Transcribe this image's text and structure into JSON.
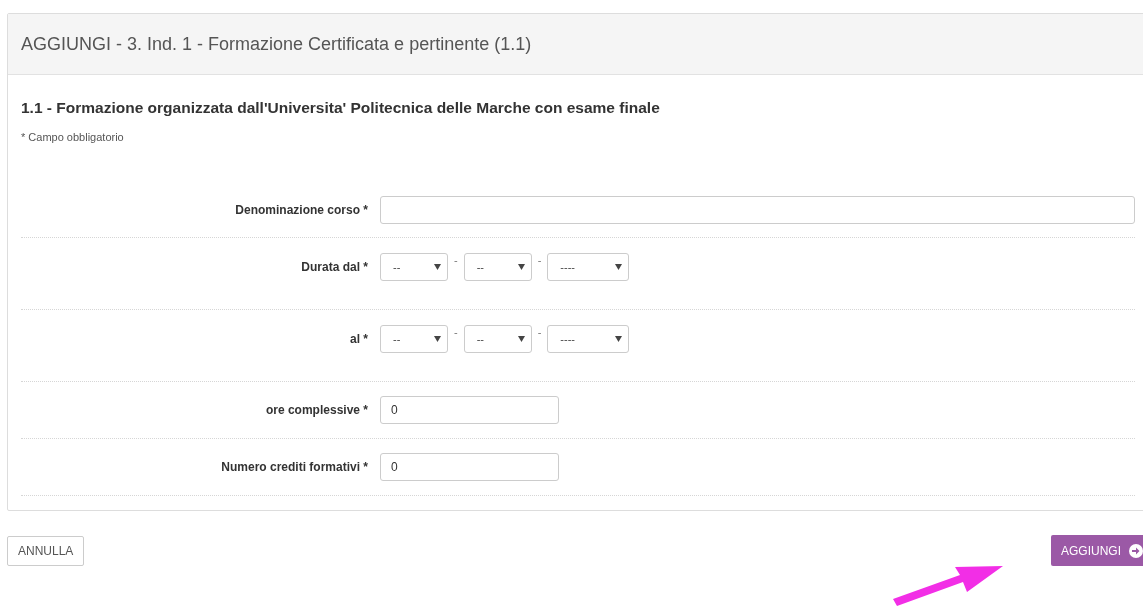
{
  "panel": {
    "title": "AGGIUNGI - 3. Ind. 1 - Formazione Certificata e pertinente (1.1)",
    "section_title": "1.1 - Formazione organizzata dall'Universita' Politecnica delle Marche con esame finale",
    "required_note": "* Campo obbligatorio",
    "fields": [
      {
        "kind": "text",
        "label": "Denominazione corso *"
      },
      {
        "kind": "date",
        "label": "Durata dal *",
        "selects": [
          "--",
          "--",
          "----"
        ],
        "separators": [
          "-",
          "-"
        ]
      },
      {
        "kind": "date",
        "label": "al *",
        "selects": [
          "--",
          "--",
          "----"
        ],
        "separators": [
          "-",
          "-"
        ]
      },
      {
        "kind": "number",
        "label": "ore complessive *",
        "value": "0"
      },
      {
        "kind": "number",
        "label": "Numero crediti formativi *",
        "value": "0"
      }
    ]
  },
  "buttons": {
    "cancel": "ANNULLA",
    "submit": "AGGIUNGI"
  }
}
